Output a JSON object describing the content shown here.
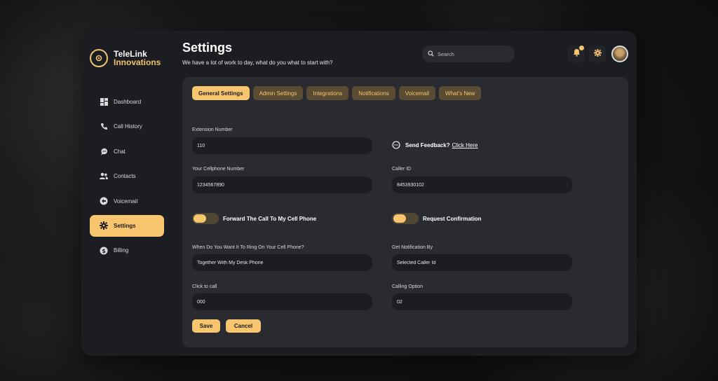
{
  "brand": {
    "name": "TeleLink",
    "sub": "Innovations",
    "accent": "#f7c56d"
  },
  "sidebar": {
    "items": [
      {
        "label": "Dashboard",
        "icon": "dashboard-icon"
      },
      {
        "label": "Call History",
        "icon": "phone-icon"
      },
      {
        "label": "Chat",
        "icon": "chat-icon"
      },
      {
        "label": "Contacts",
        "icon": "contacts-icon"
      },
      {
        "label": "Voicemail",
        "icon": "voicemail-icon"
      },
      {
        "label": "Settings",
        "icon": "gear-icon",
        "active": true
      },
      {
        "label": "Billing",
        "icon": "dollar-icon"
      }
    ]
  },
  "header": {
    "title": "Settings",
    "subtitle": "We have a lot of work to day, what do you what to start with?",
    "search_placeholder": "Search"
  },
  "tabs": [
    {
      "label": "General Settings",
      "active": true
    },
    {
      "label": "Admin Settings"
    },
    {
      "label": "Integrations"
    },
    {
      "label": "Notifications"
    },
    {
      "label": "Voicemail"
    },
    {
      "label": "What's New"
    }
  ],
  "form": {
    "extension_label": "Extension Number",
    "extension_value": "110",
    "feedback_text": "Send Feedback?",
    "feedback_link": "Click Here",
    "cellphone_label": "Your Cellphone Number",
    "cellphone_value": "1234567890",
    "callerid_label": "Caller ID",
    "callerid_value": "8453930102",
    "forward_toggle_label": "Forward The Call To My Cell Phone",
    "confirm_toggle_label": "Request Confirmation",
    "ring_label": "When Do You Want It To Ring On Your Cell Phone?",
    "ring_value": "Together With My Desk Phone",
    "notify_label": "Get Notification By",
    "notify_value": "Selected Caller Id",
    "click_to_call_label": "Click to call",
    "click_to_call_value": "000",
    "calling_option_label": "Calling Option",
    "calling_option_value": "02",
    "save_label": "Save",
    "cancel_label": "Cancel"
  }
}
